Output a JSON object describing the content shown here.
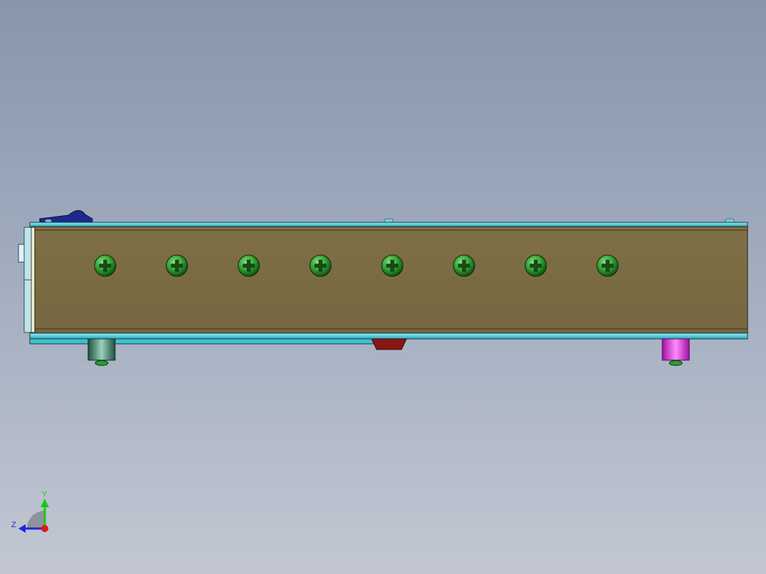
{
  "view": {
    "background_top": "#8796ab",
    "background_bottom": "#c2c7d2"
  },
  "model": {
    "name": "enclosure-side-view",
    "colors": {
      "panel": "#7b6b43",
      "panel_edge": "#4a3f22",
      "rail": "#4fd0e0",
      "rail_dark": "#2aa5b8",
      "screw": "#2c8a2c",
      "screw_light": "#6ad46a",
      "foot_left": "#3a7a66",
      "foot_right": "#e020e0",
      "switch": "#1e2a8c",
      "center_tab": "#8a1515",
      "end_cap": "#bfe4ec"
    },
    "screw_count": 8,
    "feet": [
      {
        "name": "foot-left",
        "color": "#3a7a66"
      },
      {
        "name": "foot-right",
        "color": "#e020e0"
      }
    ]
  },
  "triad": {
    "y_label": "Y",
    "z_label": "Z",
    "y_color": "#18c818",
    "z_color": "#1a2ad8",
    "x_color": "#e01818"
  }
}
